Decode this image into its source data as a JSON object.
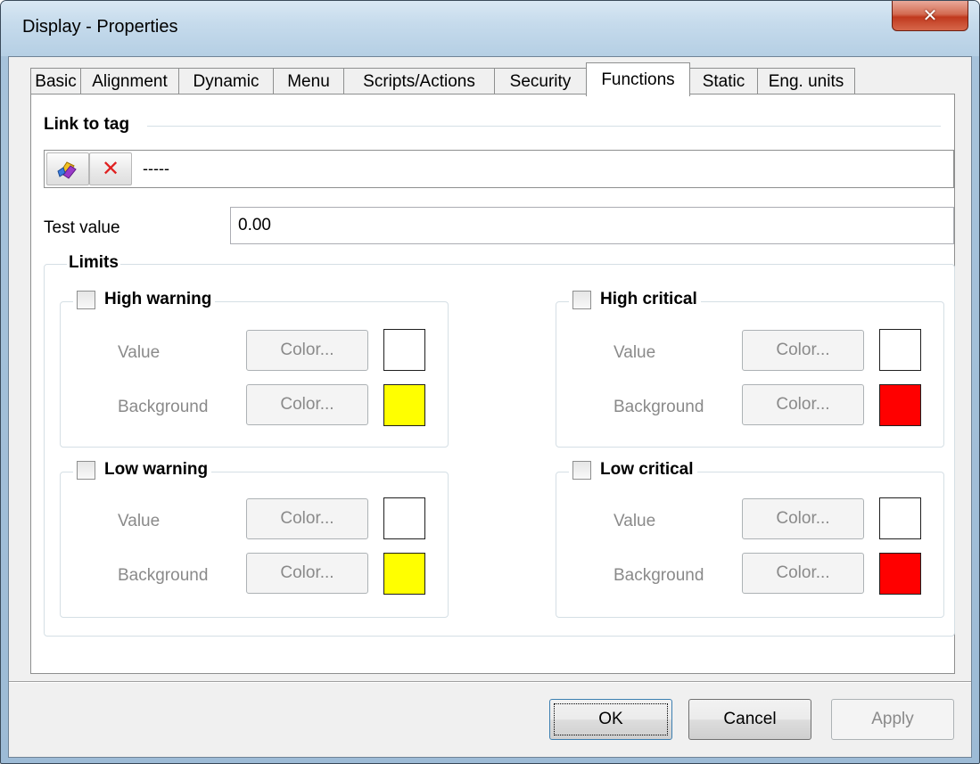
{
  "window": {
    "title": "Display - Properties",
    "close_glyph": "✕"
  },
  "tabs": [
    {
      "label": "Basic"
    },
    {
      "label": "Alignment"
    },
    {
      "label": "Dynamic"
    },
    {
      "label": "Menu"
    },
    {
      "label": "Scripts/Actions"
    },
    {
      "label": "Security"
    },
    {
      "label": "Functions",
      "active": true
    },
    {
      "label": "Static"
    },
    {
      "label": "Eng. units"
    }
  ],
  "link": {
    "title": "Link to tag",
    "tag_value": "-----",
    "tools": [
      {
        "name": "select-tag-icon"
      },
      {
        "name": "delete-icon",
        "glyph": "✕",
        "color": "#e02020"
      }
    ]
  },
  "test": {
    "label": "Test value",
    "value": "0.00"
  },
  "limits": {
    "title": "Limits",
    "groups": {
      "high_warning": {
        "title": "High warning",
        "value_label": "Value",
        "background_label": "Background",
        "value_button": "Color...",
        "background_button": "Color...",
        "value_color": "#ffffff",
        "background_color": "#ffff00"
      },
      "high_critical": {
        "title": "High critical",
        "value_label": "Value",
        "background_label": "Background",
        "value_button": "Color...",
        "background_button": "Color...",
        "value_color": "#ffffff",
        "background_color": "#ff0000"
      },
      "low_warning": {
        "title": "Low warning",
        "value_label": "Value",
        "background_label": "Background",
        "value_button": "Color...",
        "background_button": "Color...",
        "value_color": "#ffffff",
        "background_color": "#ffff00"
      },
      "low_critical": {
        "title": "Low critical",
        "value_label": "Value",
        "background_label": "Background",
        "value_button": "Color...",
        "background_button": "Color...",
        "value_color": "#ffffff",
        "background_color": "#ff0000"
      }
    }
  },
  "buttons": {
    "ok": "OK",
    "cancel": "Cancel",
    "apply": "Apply"
  }
}
